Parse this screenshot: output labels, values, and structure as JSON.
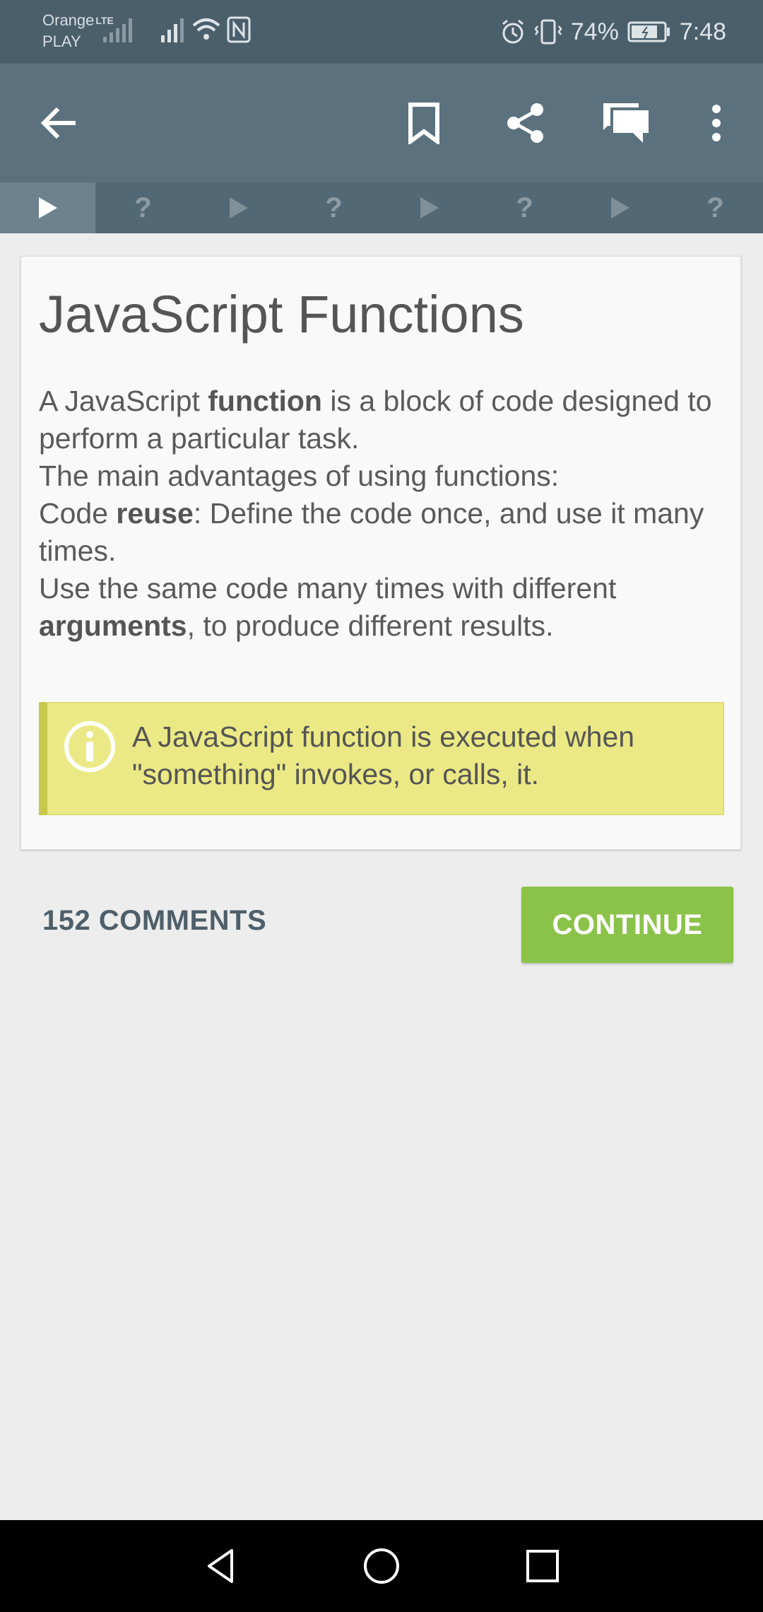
{
  "status_bar": {
    "carrier_line1": "Orange",
    "carrier_line2": "PLAY",
    "network_type": "LTE",
    "battery_percent": "74%",
    "time": "7:48",
    "icons": [
      "signal-icon",
      "wifi-icon",
      "nfc-icon",
      "alarm-icon",
      "vibrate-icon",
      "battery-icon"
    ]
  },
  "app_bar": {
    "icons": [
      "back-arrow-icon",
      "bookmark-icon",
      "share-icon",
      "comments-icon",
      "more-vert-icon"
    ]
  },
  "steps": [
    {
      "type": "play",
      "label": "",
      "active": true
    },
    {
      "type": "quiz",
      "label": "?",
      "active": false
    },
    {
      "type": "play",
      "label": "",
      "active": false
    },
    {
      "type": "quiz",
      "label": "?",
      "active": false
    },
    {
      "type": "play",
      "label": "",
      "active": false
    },
    {
      "type": "quiz",
      "label": "?",
      "active": false
    },
    {
      "type": "play",
      "label": "",
      "active": false
    },
    {
      "type": "quiz",
      "label": "?",
      "active": false
    }
  ],
  "lesson": {
    "title": "JavaScript Functions",
    "p1_a": "A JavaScript ",
    "p1_bold": "function",
    "p1_b": " is a block of code designed to perform a particular task.",
    "p2": "The main advantages of using functions:",
    "p3_a": "Code ",
    "p3_bold": "reuse",
    "p3_b": ": Define the code once, and use it many times.",
    "p4_a": "Use the same code many times with different ",
    "p4_bold": "arguments",
    "p4_b": ", to produce different results.",
    "note": "A JavaScript function is executed when \"something\" invokes, or calls, it."
  },
  "actions": {
    "comments_label": "152 COMMENTS",
    "continue_label": "CONTINUE"
  },
  "colors": {
    "status_bar": "#4b5f6b",
    "app_bar": "#5b717e",
    "step_bar": "#526874",
    "continue": "#8bc34a",
    "note_bg": "#eae985"
  }
}
